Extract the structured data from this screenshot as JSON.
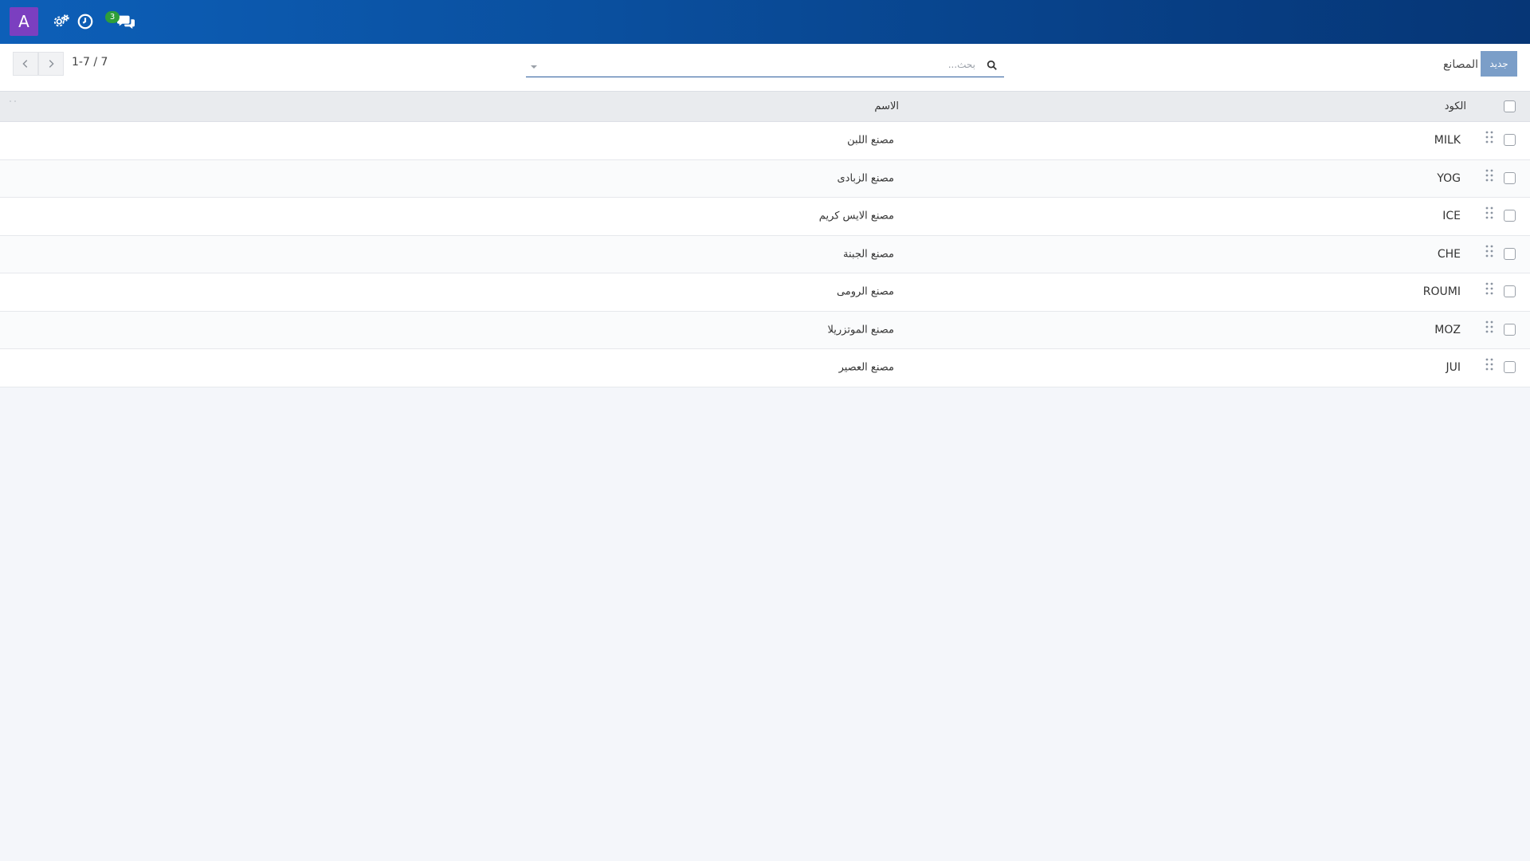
{
  "navbar": {
    "avatar_letter": "A",
    "avatar_color": "#7b3fc0",
    "icons": [
      "settings-icon",
      "clock-icon",
      "chat-icon"
    ],
    "messages_badge": "3"
  },
  "control_panel": {
    "breadcrumb": "المصانع",
    "new_button": "جديد",
    "search": {
      "placeholder": "بحث...",
      "value": ""
    },
    "pager": {
      "value": "1-7 / 7"
    }
  },
  "table": {
    "headers": {
      "code": "الكود",
      "name": "الاسم"
    },
    "rows": [
      {
        "code": "MILK",
        "name": "مصنع اللبن"
      },
      {
        "code": "YOG",
        "name": "مصنع الزبادى"
      },
      {
        "code": "ICE",
        "name": "مصنع الايس كريم"
      },
      {
        "code": "CHE",
        "name": "مصنع الجبنة"
      },
      {
        "code": "ROUMI",
        "name": "مصنع الرومى"
      },
      {
        "code": "MOZ",
        "name": "مصنع الموتزريلا"
      },
      {
        "code": "JUI",
        "name": "مصنع العصير"
      }
    ]
  },
  "colors": {
    "navbar_start": "#0d5fb8",
    "navbar_end": "#063676",
    "primary_button": "#7b9ec8",
    "badge": "#2e9e3a"
  }
}
